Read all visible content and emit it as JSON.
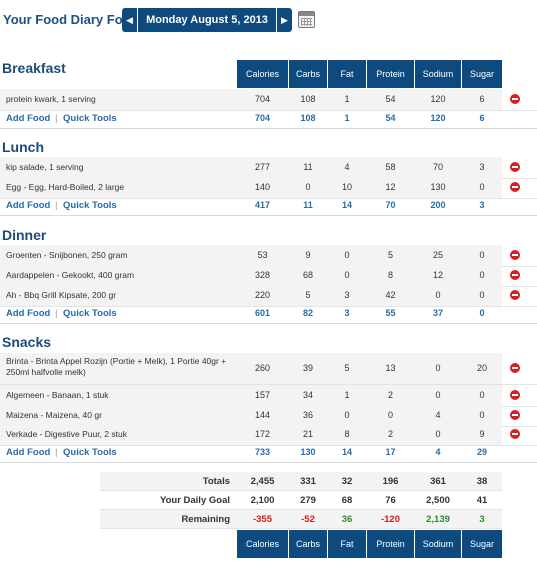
{
  "header": {
    "title": "Your Food Diary For:",
    "date": "Monday August 5, 2013",
    "prev_icon": "triangle-left",
    "next_icon": "triangle-right",
    "calendar_icon": "calendar"
  },
  "columns": [
    "Calories",
    "Carbs",
    "Fat",
    "Protein",
    "Sodium",
    "Sugar"
  ],
  "links": {
    "add_food": "Add Food",
    "separator": "|",
    "quick_tools": "Quick Tools"
  },
  "meals": [
    {
      "title": "Breakfast",
      "entries": [
        {
          "name": "protein kwark, 1 serving",
          "values": [
            "704",
            "108",
            "1",
            "54",
            "120",
            "6"
          ]
        }
      ],
      "totals": [
        "704",
        "108",
        "1",
        "54",
        "120",
        "6"
      ]
    },
    {
      "title": "Lunch",
      "entries": [
        {
          "name": "kip salade, 1 serving",
          "values": [
            "277",
            "11",
            "4",
            "58",
            "70",
            "3"
          ]
        },
        {
          "name": "Egg - Egg, Hard-Boiled, 2 large",
          "values": [
            "140",
            "0",
            "10",
            "12",
            "130",
            "0"
          ]
        }
      ],
      "totals": [
        "417",
        "11",
        "14",
        "70",
        "200",
        "3"
      ]
    },
    {
      "title": "Dinner",
      "entries": [
        {
          "name": "Groenten - Snijbonen, 250 gram",
          "values": [
            "53",
            "9",
            "0",
            "5",
            "25",
            "0"
          ]
        },
        {
          "name": "Aardappelen - Gekookt, 400 gram",
          "values": [
            "328",
            "68",
            "0",
            "8",
            "12",
            "0"
          ]
        },
        {
          "name": "Ah - Bbq Grill Kipsate, 200 gr",
          "values": [
            "220",
            "5",
            "3",
            "42",
            "0",
            "0"
          ]
        }
      ],
      "totals": [
        "601",
        "82",
        "3",
        "55",
        "37",
        "0"
      ]
    },
    {
      "title": "Snacks",
      "entries": [
        {
          "name": "Brinta - Brinta Appel Rozijn (Portie + Melk), 1 Portie 40gr + 250ml halfvolle melk)",
          "values": [
            "260",
            "39",
            "5",
            "13",
            "0",
            "20"
          ]
        },
        {
          "name": "Algemeen - Banaan, 1 stuk",
          "values": [
            "157",
            "34",
            "1",
            "2",
            "0",
            "0"
          ]
        },
        {
          "name": "Maizena - Maizena, 40 gr",
          "values": [
            "144",
            "36",
            "0",
            "0",
            "4",
            "0"
          ]
        },
        {
          "name": "Verkade - Digestive Puur, 2 stuk",
          "values": [
            "172",
            "21",
            "8",
            "2",
            "0",
            "9"
          ]
        }
      ],
      "totals": [
        "733",
        "130",
        "14",
        "17",
        "4",
        "29"
      ]
    }
  ],
  "summary": {
    "totals": {
      "label": "Totals",
      "values": [
        "2,455",
        "331",
        "32",
        "196",
        "361",
        "38"
      ]
    },
    "goal": {
      "label": "Your Daily Goal",
      "values": [
        "2,100",
        "279",
        "68",
        "76",
        "2,500",
        "41"
      ]
    },
    "remaining": {
      "label": "Remaining",
      "values": [
        "-355",
        "-52",
        "36",
        "-120",
        "2,139",
        "3"
      ],
      "status": [
        "negative",
        "negative",
        "positive",
        "negative",
        "positive",
        "positive"
      ]
    }
  },
  "colors": {
    "header_bg": "#0e4a7e",
    "link": "#2a6aa5",
    "title": "#1d4b7a",
    "negative": "#d41a1a",
    "positive": "#2e8b2e",
    "delete": "#d61f1f"
  }
}
